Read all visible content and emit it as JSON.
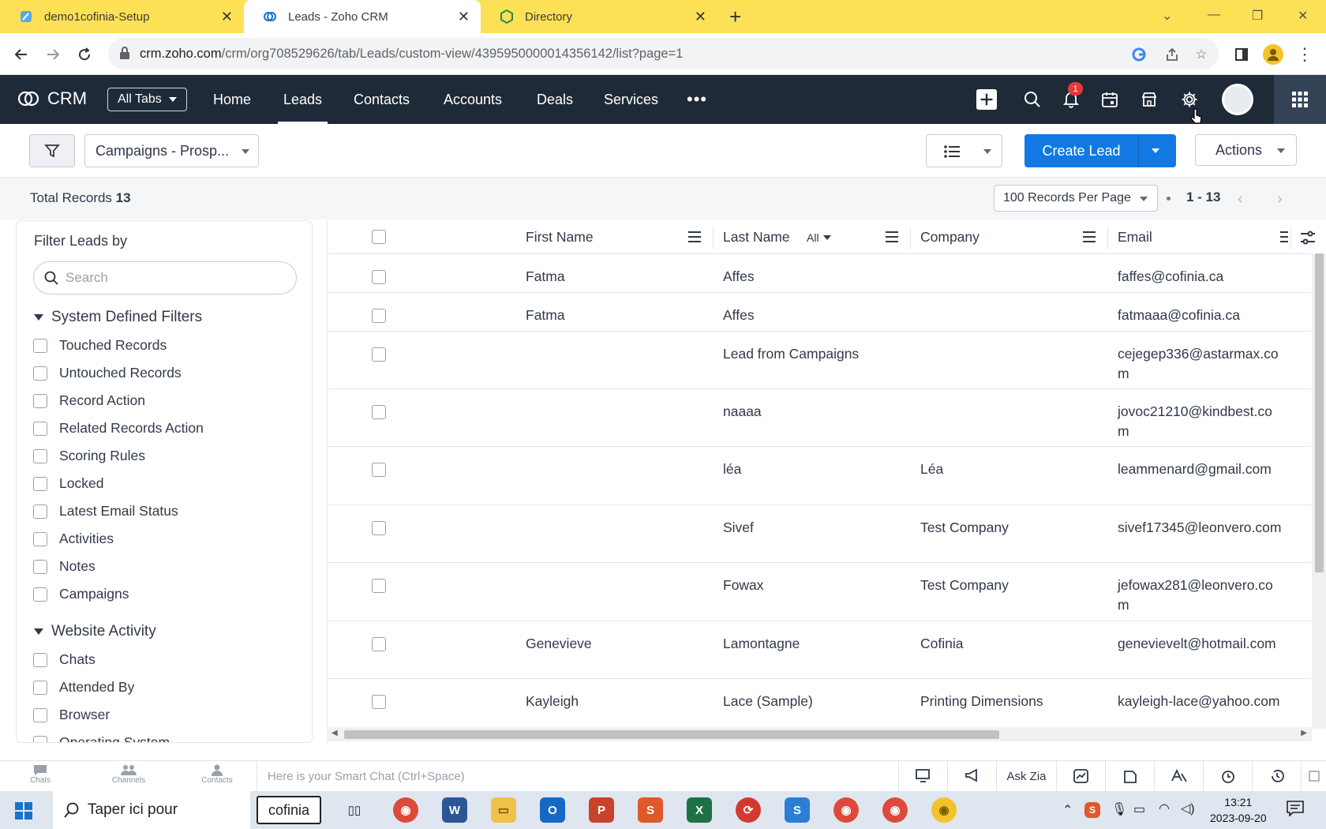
{
  "browser": {
    "tabs": [
      {
        "title": "demo1cofinia-Setup",
        "icon": "pen-icon",
        "active": false
      },
      {
        "title": "Leads - Zoho CRM",
        "icon": "zoho-crm-icon",
        "active": true
      },
      {
        "title": "Directory",
        "icon": "cube-icon",
        "active": false
      }
    ],
    "url_host": "crm.zoho.com",
    "url_path": "/crm/org708529626/tab/Leads/custom-view/4395950000014356142/list?page=1"
  },
  "crm": {
    "app_name": "CRM",
    "all_tabs_label": "All Tabs",
    "nav": [
      "Home",
      "Leads",
      "Contacts",
      "Accounts",
      "Deals",
      "Services"
    ],
    "active_nav": "Leads",
    "notification_count": "1"
  },
  "toolbar": {
    "view_name": "Campaigns - Prosp...",
    "create_label": "Create Lead",
    "actions_label": "Actions"
  },
  "info": {
    "total_label": "Total Records",
    "total_count": "13",
    "per_page": "100 Records Per Page",
    "range": "1 - 13"
  },
  "sidebar": {
    "title": "Filter Leads by",
    "search_placeholder": "Search",
    "system_group": "System Defined Filters",
    "system_filters": [
      "Touched Records",
      "Untouched Records",
      "Record Action",
      "Related Records Action",
      "Scoring Rules",
      "Locked",
      "Latest Email Status",
      "Activities",
      "Notes",
      "Campaigns"
    ],
    "website_group": "Website Activity",
    "website_filters": [
      "Chats",
      "Attended By",
      "Browser",
      "Operating System"
    ]
  },
  "table": {
    "columns": {
      "first": "First Name",
      "last": "Last Name",
      "last_filter": "All",
      "company": "Company",
      "email": "Email"
    },
    "rows": [
      {
        "first": "Fatma",
        "last": "Affes",
        "company": "",
        "email": "faffes@cofinia.ca"
      },
      {
        "first": "Fatma",
        "last": "Affes",
        "company": "",
        "email": "fatmaaa@cofinia.ca"
      },
      {
        "first": "",
        "last": "Lead from Campaigns",
        "company": "",
        "email": "cejegep336@astarmax.com"
      },
      {
        "first": "",
        "last": "naaaa",
        "company": "",
        "email": "jovoc21210@kindbest.com"
      },
      {
        "first": "",
        "last": "léa",
        "company": "Léa",
        "email": "leammenard@gmail.com"
      },
      {
        "first": "",
        "last": "Sivef",
        "company": "Test Company",
        "email": "sivef17345@leonvero.com"
      },
      {
        "first": "",
        "last": "Fowax",
        "company": "Test Company",
        "email": "jefowax281@leonvero.com"
      },
      {
        "first": "Genevieve",
        "last": "Lamontagne",
        "company": "Cofinia",
        "email": "genevievelt@hotmail.com"
      },
      {
        "first": "Kayleigh",
        "last": "Lace (Sample)",
        "company": "Printing Dimensions",
        "email": "kayleigh-lace@yahoo.com"
      }
    ]
  },
  "bottom": {
    "chats": "Chats",
    "channels": "Channels",
    "contacts": "Contacts",
    "smart_chat": "Here is your Smart Chat (Ctrl+Space)",
    "ask_zia": "Ask Zia"
  },
  "taskbar": {
    "search_text": "Taper ici pour",
    "cofinia": "cofinia",
    "time": "13:21",
    "date": "2023-09-20"
  },
  "colors": {
    "tabstrip": "#fce156",
    "header": "#1f2a38",
    "primary": "#1279e3"
  }
}
